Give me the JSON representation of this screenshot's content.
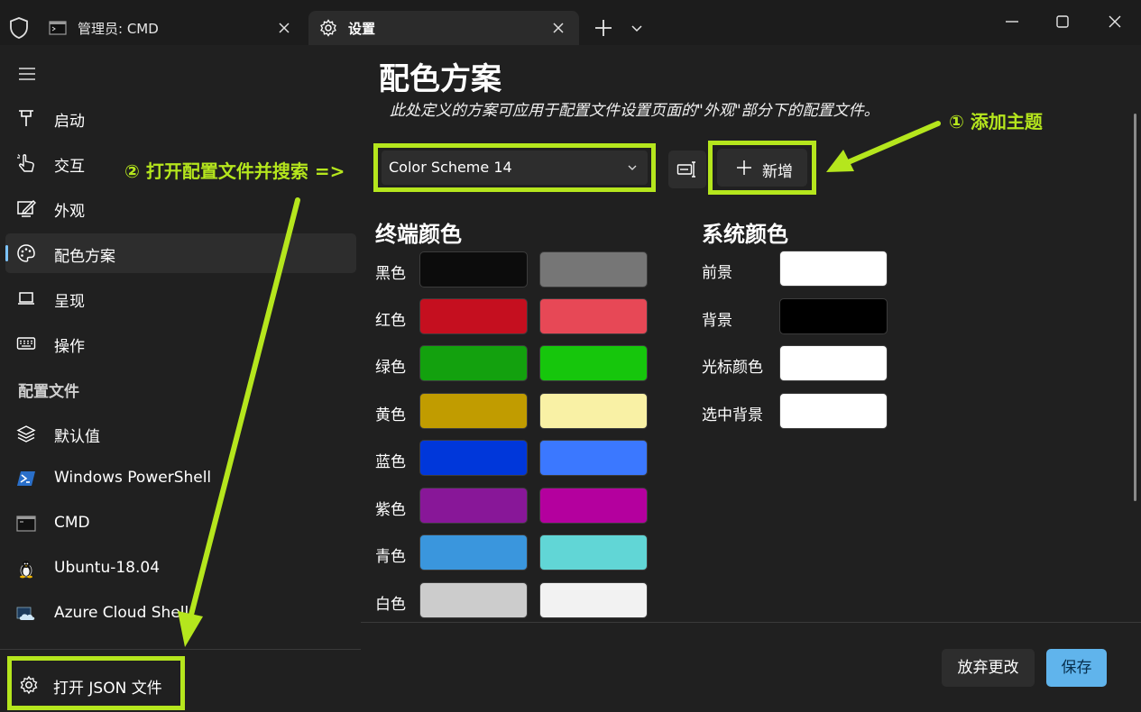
{
  "titlebar": {
    "tabs": [
      {
        "label": "管理员: CMD",
        "icon": "terminal-icon"
      },
      {
        "label": "设置",
        "icon": "gear-icon"
      }
    ]
  },
  "sidebar": {
    "items": [
      {
        "label": "启动",
        "icon": "startup-pin-icon"
      },
      {
        "label": "交互",
        "icon": "hand-pointer-icon"
      },
      {
        "label": "外观",
        "icon": "appearance-edit-icon"
      },
      {
        "label": "配色方案",
        "icon": "palette-icon",
        "selected": true
      },
      {
        "label": "呈现",
        "icon": "laptop-icon"
      },
      {
        "label": "操作",
        "icon": "keyboard-icon"
      }
    ],
    "profiles_header": "配置文件",
    "profiles": [
      {
        "label": "默认值",
        "icon": "layers-icon"
      },
      {
        "label": "Windows PowerShell",
        "icon": "powershell-icon"
      },
      {
        "label": "CMD",
        "icon": "cmd-icon"
      },
      {
        "label": "Ubuntu-18.04",
        "icon": "linux-penguin-icon"
      },
      {
        "label": "Azure Cloud Shell",
        "icon": "azure-cloud-icon"
      }
    ],
    "open_json": "打开 JSON 文件"
  },
  "main": {
    "title": "配色方案",
    "description": "此处定义的方案可应用于配置文件设置页面的\"外观\"部分下的配置文件。",
    "scheme_select_value": "Color Scheme 14",
    "new_button": "新增",
    "terminal_colors_title": "终端颜色",
    "system_colors_title": "系统颜色",
    "terminal_colors": [
      {
        "label": "黑色",
        "normal": "#0c0c0c",
        "bright": "#767676"
      },
      {
        "label": "红色",
        "normal": "#c50f1f",
        "bright": "#e74856"
      },
      {
        "label": "绿色",
        "normal": "#13a10e",
        "bright": "#16c60c"
      },
      {
        "label": "黄色",
        "normal": "#c19c00",
        "bright": "#f9f1a5"
      },
      {
        "label": "蓝色",
        "normal": "#0037da",
        "bright": "#3b78ff"
      },
      {
        "label": "紫色",
        "normal": "#881798",
        "bright": "#b4009e"
      },
      {
        "label": "青色",
        "normal": "#3a96dd",
        "bright": "#61d6d6"
      },
      {
        "label": "白色",
        "normal": "#cccccc",
        "bright": "#f2f2f2"
      }
    ],
    "system_colors": [
      {
        "label": "前景",
        "color": "#ffffff"
      },
      {
        "label": "背景",
        "color": "#000000"
      },
      {
        "label": "光标颜色",
        "color": "#ffffff"
      },
      {
        "label": "选中背景",
        "color": "#ffffff"
      }
    ],
    "discard_button": "放弃更改",
    "save_button": "保存"
  },
  "annotations": {
    "add_theme": "① 添加主题",
    "open_and_search": "② 打开配置文件并搜索 =>",
    "highlight_color": "#b5e61d"
  }
}
